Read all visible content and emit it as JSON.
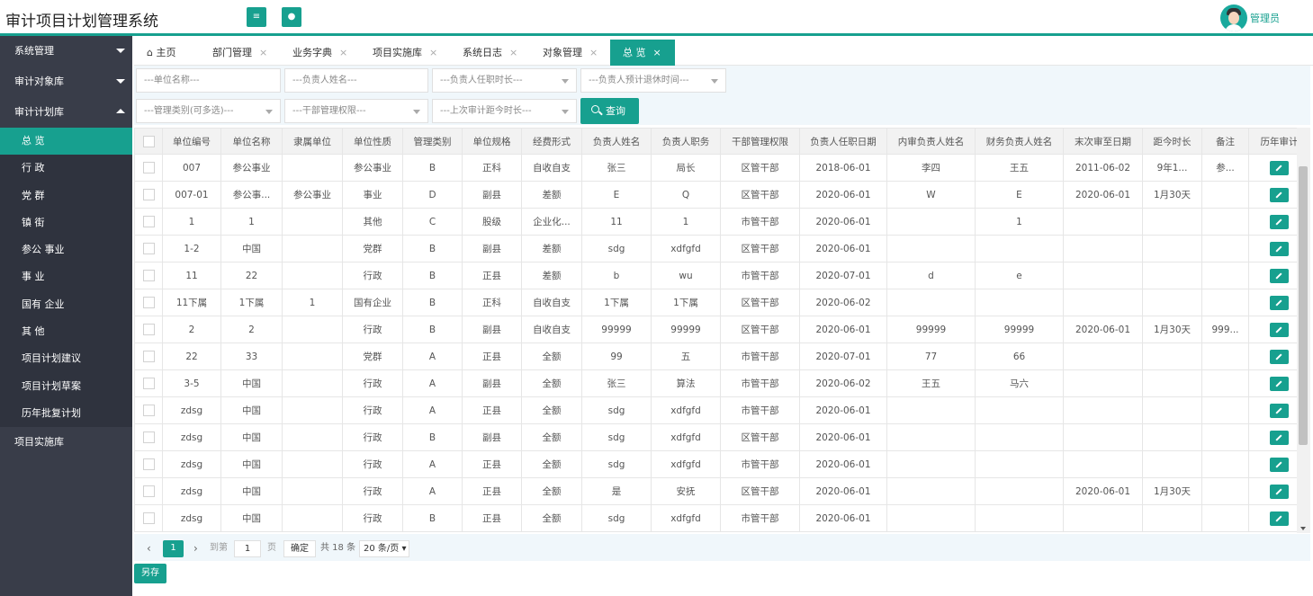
{
  "app": {
    "title": "审计项目计划管理系统",
    "user": "管理员"
  },
  "sidebar": {
    "groups": [
      {
        "label": "系统管理"
      },
      {
        "label": "审计对象库"
      },
      {
        "label": "审计计划库"
      }
    ],
    "sub_items": [
      {
        "label": "总 览"
      },
      {
        "label": "行 政"
      },
      {
        "label": "党 群"
      },
      {
        "label": "镇 街"
      },
      {
        "label": "参公 事业"
      },
      {
        "label": "事 业"
      },
      {
        "label": "国有 企业"
      },
      {
        "label": "其 他"
      },
      {
        "label": "项目计划建议"
      },
      {
        "label": "项目计划草案"
      },
      {
        "label": "历年批复计划"
      }
    ],
    "bottom": {
      "label": "项目实施库"
    }
  },
  "tabs": [
    {
      "label": "主页"
    },
    {
      "label": "部门管理"
    },
    {
      "label": "业务字典"
    },
    {
      "label": "项目实施库"
    },
    {
      "label": "系统日志"
    },
    {
      "label": "对象管理"
    },
    {
      "label": "总 览"
    }
  ],
  "filters": {
    "unit_name": "---单位名称---",
    "leader_name": "---负责人姓名---",
    "tenure": "---负责人任职时长---",
    "retire": "---负责人预计退休时间---",
    "mgmt_type": "---管理类别(可多选)---",
    "cadre_auth": "---干部管理权限---",
    "last_audit": "---上次审计距今时长---",
    "query_label": "查询"
  },
  "table": {
    "headers": [
      "单位编号",
      "单位名称",
      "隶属单位",
      "单位性质",
      "管理类别",
      "单位规格",
      "经费形式",
      "负责人姓名",
      "负责人职务",
      "干部管理权限",
      "负责人任职日期",
      "内审负责人姓名",
      "财务负责人姓名",
      "末次审至日期",
      "距今时长",
      "备注",
      "历年审计"
    ],
    "rows": [
      [
        "007",
        "参公事业",
        "",
        "参公事业",
        "B",
        "正科",
        "自收自支",
        "张三",
        "局长",
        "区管干部",
        "2018-06-01",
        "李四",
        "王五",
        "2011-06-02",
        "9年1...",
        "参..."
      ],
      [
        "007-01",
        "参公事...",
        "参公事业",
        "事业",
        "D",
        "副县",
        "差额",
        "E",
        "Q",
        "区管干部",
        "2020-06-01",
        "W",
        "E",
        "2020-06-01",
        "1月30天",
        ""
      ],
      [
        "1",
        "1",
        "",
        "其他",
        "C",
        "股级",
        "企业化...",
        "11",
        "1",
        "市管干部",
        "2020-06-01",
        "",
        "1",
        "",
        "",
        ""
      ],
      [
        "1-2",
        "中国",
        "",
        "党群",
        "B",
        "副县",
        "差额",
        "sdg",
        "xdfgfd",
        "区管干部",
        "2020-06-01",
        "",
        "",
        "",
        "",
        ""
      ],
      [
        "11",
        "22",
        "",
        "行政",
        "B",
        "正县",
        "差额",
        "b",
        "wu",
        "市管干部",
        "2020-07-01",
        "d",
        "e",
        "",
        "",
        ""
      ],
      [
        "11下属",
        "1下属",
        "1",
        "国有企业",
        "B",
        "正科",
        "自收自支",
        "1下属",
        "1下属",
        "区管干部",
        "2020-06-02",
        "",
        "",
        "",
        "",
        ""
      ],
      [
        "2",
        "2",
        "",
        "行政",
        "B",
        "副县",
        "自收自支",
        "99999",
        "99999",
        "区管干部",
        "2020-06-01",
        "99999",
        "99999",
        "2020-06-01",
        "1月30天",
        "999..."
      ],
      [
        "22",
        "33",
        "",
        "党群",
        "A",
        "正县",
        "全额",
        "99",
        "五",
        "市管干部",
        "2020-07-01",
        "77",
        "66",
        "",
        "",
        ""
      ],
      [
        "3-5",
        "中国",
        "",
        "行政",
        "A",
        "副县",
        "全额",
        "张三",
        "算法",
        "市管干部",
        "2020-06-02",
        "王五",
        "马六",
        "",
        "",
        ""
      ],
      [
        "zdsg",
        "中国",
        "",
        "行政",
        "A",
        "正县",
        "全额",
        "sdg",
        "xdfgfd",
        "市管干部",
        "2020-06-01",
        "",
        "",
        "",
        "",
        ""
      ],
      [
        "zdsg",
        "中国",
        "",
        "行政",
        "B",
        "副县",
        "全额",
        "sdg",
        "xdfgfd",
        "区管干部",
        "2020-06-01",
        "",
        "",
        "",
        "",
        ""
      ],
      [
        "zdsg",
        "中国",
        "",
        "行政",
        "A",
        "正县",
        "全额",
        "sdg",
        "xdfgfd",
        "市管干部",
        "2020-06-01",
        "",
        "",
        "",
        "",
        ""
      ],
      [
        "zdsg",
        "中国",
        "",
        "行政",
        "A",
        "正县",
        "全额",
        "是",
        "安抚",
        "区管干部",
        "2020-06-01",
        "",
        "",
        "2020-06-01",
        "1月30天",
        ""
      ],
      [
        "zdsg",
        "中国",
        "",
        "行政",
        "B",
        "正县",
        "全额",
        "sdg",
        "xdfgfd",
        "市管干部",
        "2020-06-01",
        "",
        "",
        "",
        "",
        ""
      ]
    ]
  },
  "pager": {
    "current": "1",
    "goto_label": "到第",
    "page_input": "1",
    "page_unit": "页",
    "confirm": "确定",
    "total": "共 18 条",
    "page_size": "20 条/页"
  },
  "save_label": "另存"
}
